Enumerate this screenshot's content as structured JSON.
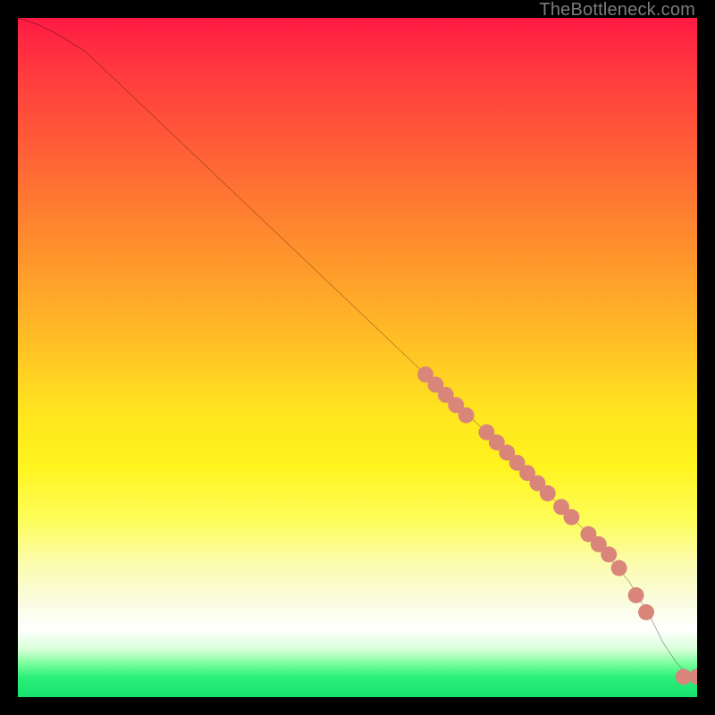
{
  "watermark": "TheBottleneck.com",
  "chart_data": {
    "type": "line",
    "title": "",
    "xlabel": "",
    "ylabel": "",
    "xlim": [
      0,
      100
    ],
    "ylim": [
      0,
      100
    ],
    "grid": false,
    "legend": false,
    "background_gradient": {
      "direction": "vertical",
      "stops": [
        {
          "pos": 0.0,
          "color": "#ff1a44"
        },
        {
          "pos": 0.3,
          "color": "#ff8a2e"
        },
        {
          "pos": 0.55,
          "color": "#ffe51f"
        },
        {
          "pos": 0.8,
          "color": "#fafce0"
        },
        {
          "pos": 0.9,
          "color": "#ffffff"
        },
        {
          "pos": 1.0,
          "color": "#15e26e"
        }
      ]
    },
    "series": [
      {
        "name": "bottleneck-curve",
        "color": "#000000",
        "x": [
          0,
          3,
          6,
          10,
          20,
          30,
          40,
          50,
          60,
          70,
          80,
          85,
          90,
          93,
          95,
          97,
          99,
          100
        ],
        "y": [
          100,
          99,
          97.5,
          95,
          85.5,
          76,
          66.5,
          57,
          47.5,
          38,
          28,
          23,
          17,
          12,
          8,
          5,
          3,
          3
        ]
      }
    ],
    "scatter": [
      {
        "name": "highlight-points",
        "color": "#d9857a",
        "radius": 9,
        "points": [
          {
            "x": 60,
            "y": 47.5
          },
          {
            "x": 61.5,
            "y": 46
          },
          {
            "x": 63,
            "y": 44.5
          },
          {
            "x": 64.5,
            "y": 43
          },
          {
            "x": 66,
            "y": 41.5
          },
          {
            "x": 69,
            "y": 39
          },
          {
            "x": 70.5,
            "y": 37.5
          },
          {
            "x": 72,
            "y": 36
          },
          {
            "x": 73.5,
            "y": 34.5
          },
          {
            "x": 75,
            "y": 33
          },
          {
            "x": 76.5,
            "y": 31.5
          },
          {
            "x": 78,
            "y": 30
          },
          {
            "x": 80,
            "y": 28
          },
          {
            "x": 81.5,
            "y": 26.5
          },
          {
            "x": 84,
            "y": 24
          },
          {
            "x": 85.5,
            "y": 22.5
          },
          {
            "x": 87,
            "y": 21
          },
          {
            "x": 88.5,
            "y": 19
          },
          {
            "x": 91,
            "y": 15
          },
          {
            "x": 92.5,
            "y": 12.5
          },
          {
            "x": 98,
            "y": 3
          },
          {
            "x": 100,
            "y": 3
          }
        ]
      }
    ]
  }
}
